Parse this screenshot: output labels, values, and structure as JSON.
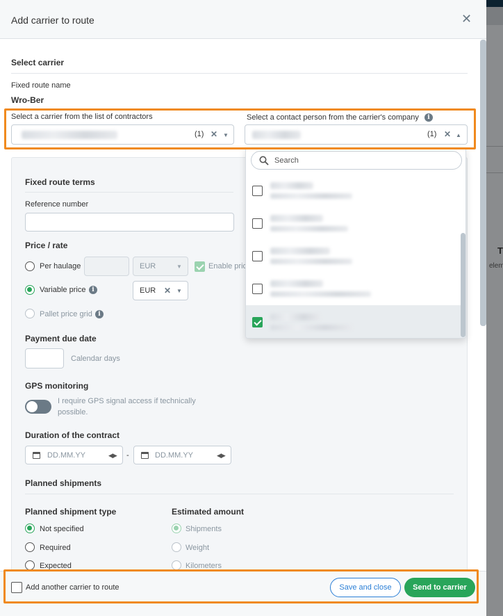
{
  "modal": {
    "title": "Add carrier to route",
    "close_icon": "close-icon"
  },
  "carrier": {
    "section_title": "Select carrier",
    "route_name_label": "Fixed route name",
    "route_name_value": "Wro-Ber",
    "carrier_label": "Select a carrier from the list of contractors",
    "carrier_count": "(1)",
    "contact_label": "Select a contact person from the carrier's company",
    "contact_count": "(1)"
  },
  "dropdown": {
    "search_placeholder": "Search",
    "items": [
      {
        "checked": false
      },
      {
        "checked": false
      },
      {
        "checked": false
      },
      {
        "checked": false
      },
      {
        "checked": true
      }
    ]
  },
  "terms": {
    "title": "Fixed route terms",
    "reference_label": "Reference number",
    "reference_value": "",
    "price_title": "Price / rate",
    "per_haulage_label": "Per haulage",
    "per_haulage_currency": "EUR",
    "enable_price_label": "Enable pric",
    "variable_price_label": "Variable price",
    "variable_currency": "EUR",
    "pallet_grid_label": "Pallet price grid",
    "payment_title": "Payment due date",
    "calendar_days_label": "Calendar days",
    "gps_title": "GPS monitoring",
    "gps_text_1": "I require GPS signal access if technically",
    "gps_text_2": "possible.",
    "duration_title": "Duration of the contract",
    "date_placeholder_1": "DD.MM.YY",
    "date_separator": "-",
    "date_placeholder_2": "DD.MM.YY",
    "planned_title": "Planned shipments",
    "shipment_type_title": "Planned shipment type",
    "shipment_types": [
      "Not specified",
      "Required",
      "Expected"
    ],
    "estimated_title": "Estimated amount",
    "estimated_options": [
      "Shipments",
      "Weight",
      "Kilometers"
    ]
  },
  "footer": {
    "add_another_label": "Add another carrier to route",
    "save_close_label": "Save and close",
    "send_label": "Send to carrier"
  },
  "background": {
    "letter": "T",
    "text": "eleme"
  },
  "colors": {
    "accent_green": "#29a55a",
    "accent_blue": "#2b7fd6",
    "highlight_orange": "#f08a1e"
  }
}
